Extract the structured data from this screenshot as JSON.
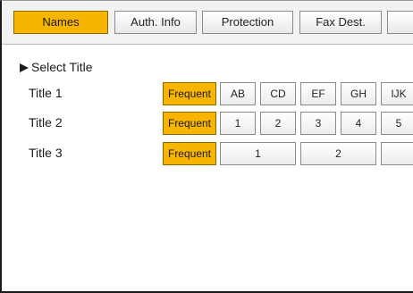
{
  "tabs": [
    "Names",
    "Auth. Info",
    "Protection",
    "Fax Dest.",
    ""
  ],
  "select_title": "Select Title",
  "rows": [
    {
      "label": "Title 1",
      "frequent": "Frequent",
      "keys": [
        "AB",
        "CD",
        "EF",
        "GH",
        "IJK"
      ]
    },
    {
      "label": "Title 2",
      "frequent": "Frequent",
      "keys": [
        "1",
        "2",
        "3",
        "4",
        "5"
      ]
    },
    {
      "label": "Title 3",
      "frequent": "Frequent",
      "keys": [
        "1",
        "2",
        ""
      ]
    }
  ],
  "colors": {
    "active": "#f7b500",
    "border": "#8a8a8a"
  }
}
